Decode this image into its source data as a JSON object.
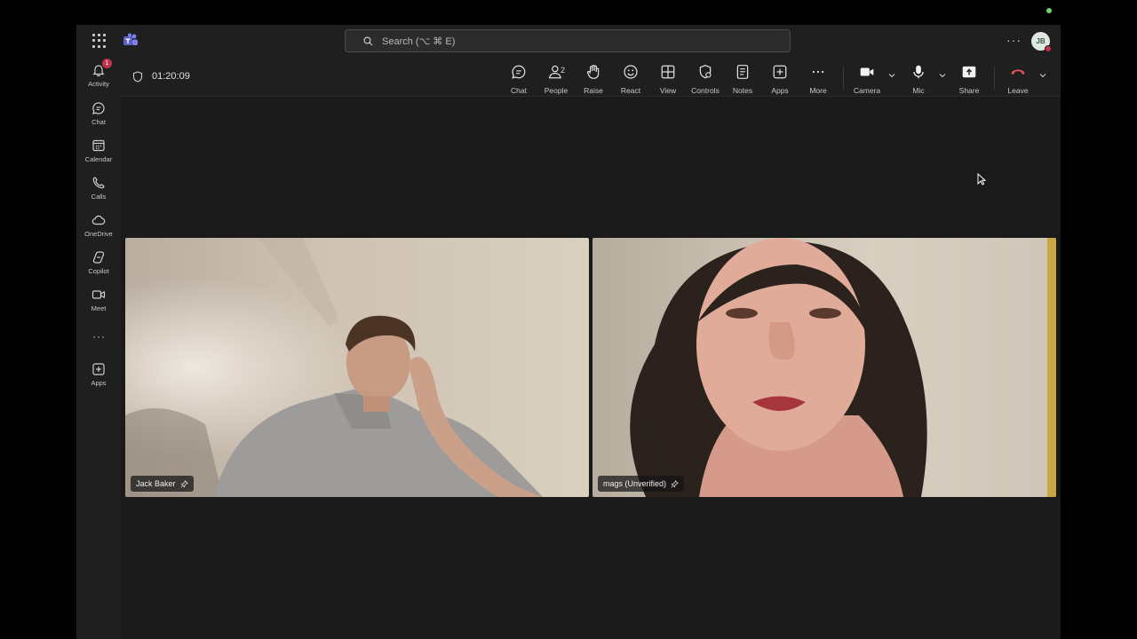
{
  "titlebar": {
    "search_placeholder": "Search (⌥ ⌘ E)",
    "more_label": "···",
    "avatar_initials": "JB"
  },
  "rail": {
    "items": [
      {
        "label": "Activity",
        "icon": "bell-icon",
        "badge": "1"
      },
      {
        "label": "Chat",
        "icon": "chat-icon"
      },
      {
        "label": "Calendar",
        "icon": "calendar-icon"
      },
      {
        "label": "Calls",
        "icon": "phone-icon"
      },
      {
        "label": "OneDrive",
        "icon": "cloud-icon"
      },
      {
        "label": "Copilot",
        "icon": "copilot-icon"
      },
      {
        "label": "Meet",
        "icon": "video-camera-icon"
      },
      {
        "label": "Apps",
        "icon": "add-apps-icon"
      }
    ],
    "more": "···"
  },
  "meeting": {
    "timer": "01:20:09",
    "controls": [
      {
        "label": "Chat",
        "icon": "chat-icon"
      },
      {
        "label": "People",
        "icon": "people-icon",
        "count": "2"
      },
      {
        "label": "Raise",
        "icon": "raise-hand-icon"
      },
      {
        "label": "React",
        "icon": "smiley-icon"
      },
      {
        "label": "View",
        "icon": "grid-view-icon"
      },
      {
        "label": "Controls",
        "icon": "controls-icon"
      },
      {
        "label": "Notes",
        "icon": "notes-icon"
      },
      {
        "label": "Apps",
        "icon": "add-apps-icon"
      },
      {
        "label": "More",
        "icon": "more-dots-icon"
      },
      {
        "label": "Camera",
        "icon": "camera-icon"
      },
      {
        "label": "Mic",
        "icon": "mic-icon"
      },
      {
        "label": "Share",
        "icon": "share-icon"
      },
      {
        "label": "Leave",
        "icon": "hang-up-icon"
      }
    ],
    "participants": [
      {
        "name": "Jack Baker"
      },
      {
        "name": "mags (Unverified)"
      }
    ]
  },
  "colors": {
    "background": "#1a1a1a",
    "badge": "#c4314b",
    "leave": "#c4314b",
    "presence_online": "#6bd46b"
  }
}
